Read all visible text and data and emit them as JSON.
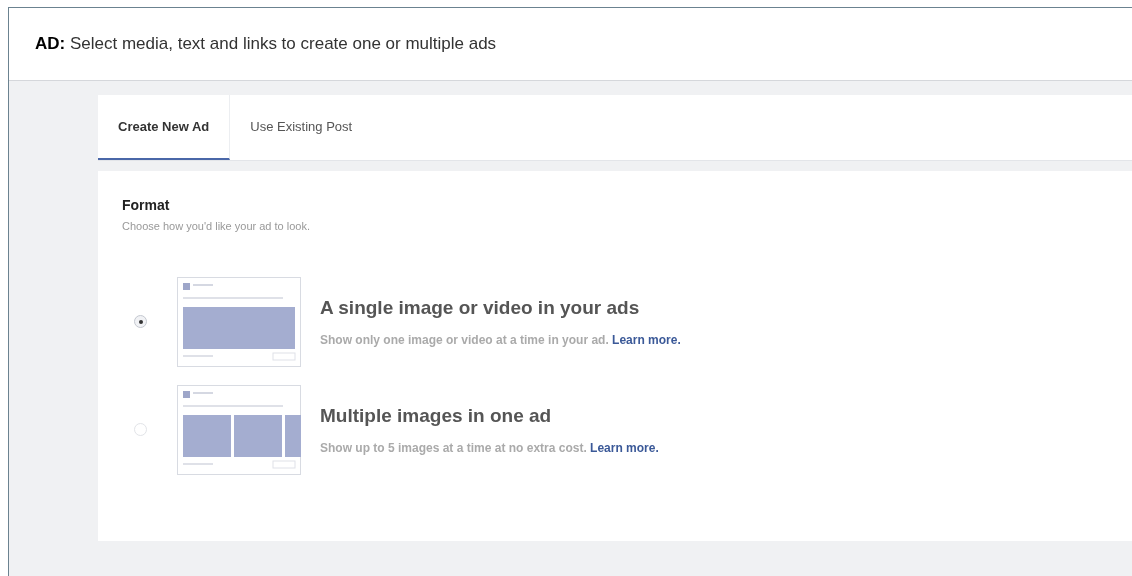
{
  "header": {
    "label": "AD:",
    "text": "Select media, text and links to create one or multiple ads"
  },
  "tabs": [
    {
      "label": "Create New Ad",
      "selected": true
    },
    {
      "label": "Use Existing Post",
      "selected": false
    }
  ],
  "format": {
    "title": "Format",
    "subtitle": "Choose how you'd like your ad to look.",
    "options": [
      {
        "kind": "single",
        "title": "A single image or video in your ads",
        "description": "Show only one image or video at a time in your ad.",
        "link": "Learn more.",
        "selected": true
      },
      {
        "kind": "multiple",
        "title": "Multiple images in one ad",
        "description": "Show up to 5 images at a time at no extra cost.",
        "link": "Learn more.",
        "selected": false
      }
    ]
  }
}
